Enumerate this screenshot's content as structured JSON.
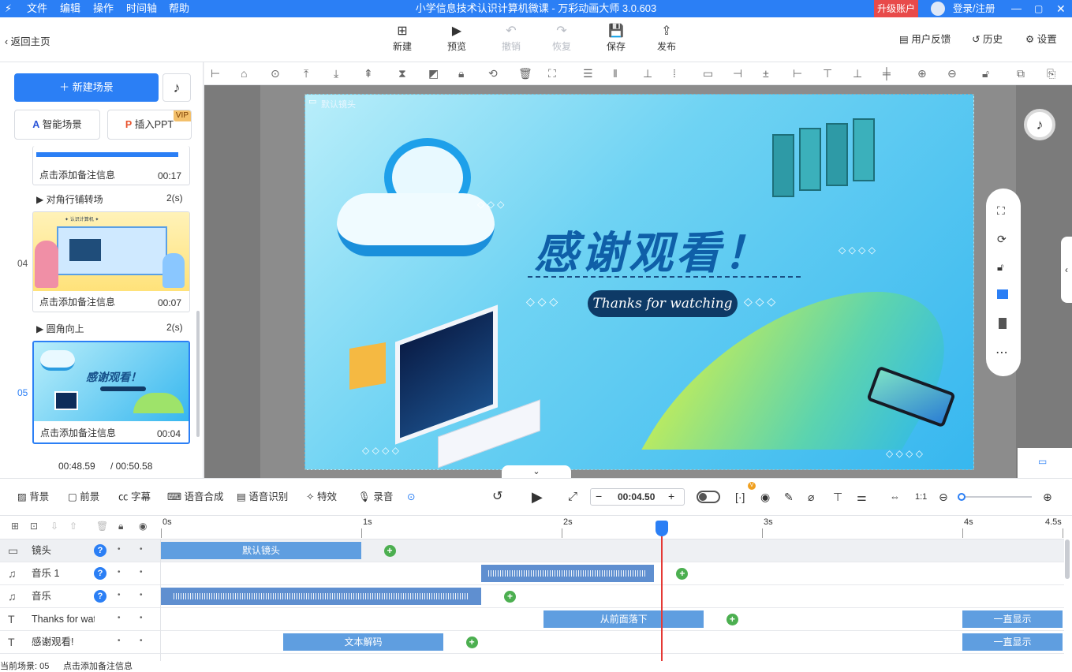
{
  "app": {
    "title": "小学信息技术认识计算机微课 - 万彩动画大师 3.0.603",
    "menu": [
      "文件",
      "编辑",
      "操作",
      "时间轴",
      "帮助"
    ],
    "upgrade_label": "升级账户",
    "login_label": "登录/注册"
  },
  "toolbar": {
    "back_label": "返回主页",
    "buttons": [
      {
        "label": "新建",
        "icon": "plus-box-icon",
        "enabled": true
      },
      {
        "label": "预览",
        "icon": "play-icon",
        "enabled": true
      },
      {
        "label": "撤销",
        "icon": "undo-icon",
        "enabled": false
      },
      {
        "label": "恢复",
        "icon": "redo-icon",
        "enabled": false
      },
      {
        "label": "保存",
        "icon": "save-icon",
        "enabled": true
      },
      {
        "label": "发布",
        "icon": "publish-icon",
        "enabled": true
      }
    ],
    "feedback_label": "用户反馈",
    "history_label": "历史",
    "settings_label": "设置"
  },
  "left_panel": {
    "new_scene_label": "新建场景",
    "smart_scene_label": "智能场景",
    "insert_ppt_label": "插入PPT",
    "vip_badge": "VIP",
    "scenes": [
      {
        "index": "",
        "note": "点击添加备注信息",
        "duration": "00:17"
      },
      {
        "index": "04",
        "note": "点击添加备注信息",
        "duration": "00:07"
      },
      {
        "index": "05",
        "note": "点击添加备注信息",
        "duration": "00:04"
      }
    ],
    "transitions": [
      {
        "name": "对角行铺转场",
        "duration": "2(s)"
      },
      {
        "name": "圆角向上",
        "duration": "2(s)"
      }
    ],
    "scene4_thumb_title": "✦ 认识计算机 ✦",
    "scene5_thumb_title": "感谢观看！",
    "current_time": "00:48.59",
    "total_time": "/ 00:50.58"
  },
  "stage": {
    "camera_label": "默认镜头",
    "headline": "感谢观看！",
    "subtitle": "Thanks for watching"
  },
  "bottom_bar": {
    "items": [
      "背景",
      "前景",
      "字幕",
      "语音合成",
      "语音识别",
      "特效",
      "录音"
    ],
    "time": "00:04.50"
  },
  "timeline": {
    "ticks": [
      "0s",
      "1s",
      "2s",
      "3s",
      "4s",
      "4.5s"
    ],
    "playhead_seconds": 2.5,
    "tracks": [
      {
        "name": "镜头",
        "icon": "camera-icon",
        "clips": [
          {
            "label": "默认镜头",
            "start": 0,
            "end": 1.0
          }
        ],
        "plus_at": 1.14
      },
      {
        "name": "音乐 1",
        "icon": "music-note-icon",
        "clips": [
          {
            "label": "",
            "start": 1.6,
            "end": 2.46,
            "wave": true
          }
        ],
        "plus_at": 2.6
      },
      {
        "name": "音乐",
        "icon": "music-note-icon",
        "clips": [
          {
            "label": "",
            "start": 0,
            "end": 1.6,
            "wave": true
          }
        ],
        "plus_at": 1.74
      },
      {
        "name": "Thanks for watching",
        "icon": "text-icon",
        "clips": [
          {
            "label": "从前面落下",
            "start": 1.91,
            "end": 2.71
          },
          {
            "label": "一直显示",
            "start": 4.0,
            "end": 4.5
          }
        ],
        "plus_at": 2.85
      },
      {
        "name": "感谢观看!",
        "icon": "text-icon",
        "clips": [
          {
            "label": "文本解码",
            "start": 0.61,
            "end": 1.41
          },
          {
            "label": "一直显示",
            "start": 4.0,
            "end": 4.5
          }
        ],
        "plus_at": 1.55
      }
    ]
  },
  "status": {
    "scene_label": "当前场景: 05",
    "note_label": "点击添加备注信息"
  },
  "colors": {
    "primary": "#2b7ff5",
    "clip": "#5f9ee0",
    "plus": "#4caf50",
    "playhead": "#e53935",
    "upgrade": "#e84a4a"
  }
}
